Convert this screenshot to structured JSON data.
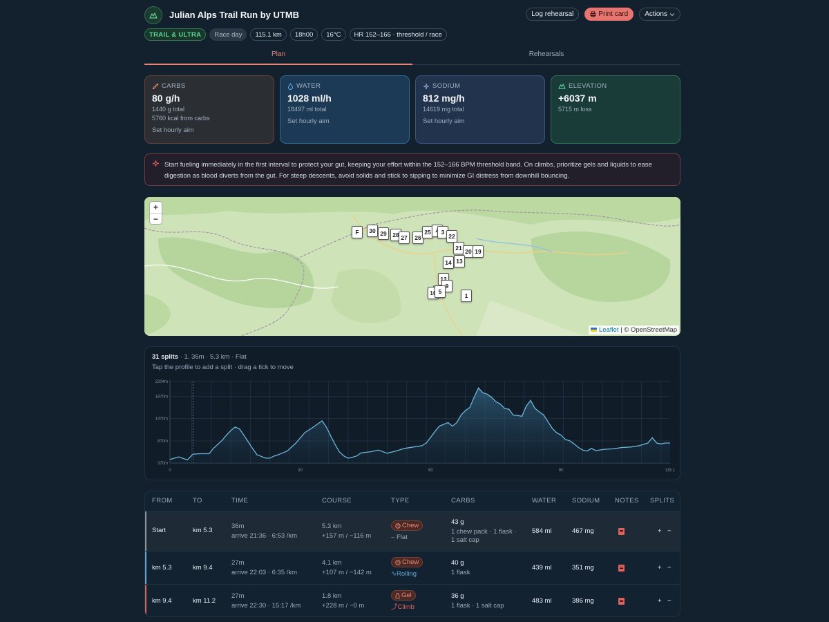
{
  "header": {
    "title": "Julian Alps Trail Run by UTMB",
    "buttons": {
      "log": "Log rehearsal",
      "print": "Print card",
      "actions": "Actions"
    },
    "chips": [
      "TRAIL & ULTRA",
      "Race day",
      "115.1 km",
      "18h00",
      "16°C",
      "HR 152–166 · threshold / race"
    ]
  },
  "tabs": [
    "Plan",
    "Rehearsals"
  ],
  "cards": [
    {
      "label": "CARBS",
      "value": "80 g/h",
      "sub1": "1440 g total",
      "sub2": "5760 kcal from carbs",
      "aim": "Set hourly aim"
    },
    {
      "label": "WATER",
      "value": "1028 ml/h",
      "sub1": "18497 ml total",
      "aim": "Set hourly aim"
    },
    {
      "label": "SODIUM",
      "value": "812 mg/h",
      "sub1": "14619 mg total",
      "aim": "Set hourly aim"
    },
    {
      "label": "ELEVATION",
      "value": "+6037 m",
      "sub1": "5715 m loss"
    }
  ],
  "tip": "Start fueling immediately in the first interval to protect your gut, keeping your effort within the 152–166 BPM threshold band. On climbs, prioritize gels and liquids to ease digestion as blood diverts from the gut. For steep descents, avoid solids and stick to sipping to minimize GI distress from downhill bouncing.",
  "map": {
    "zoom_in": "+",
    "zoom_out": "−",
    "attribution_leaflet": "Leaflet",
    "attribution_osm": "| © OpenStreetMap",
    "markers": [
      "F",
      "30",
      "29",
      "28",
      "27",
      "26",
      "25",
      "4",
      "3",
      "22",
      "21",
      "20",
      "19",
      "14",
      "13",
      "12",
      "11",
      "10",
      "9",
      "5",
      "1"
    ]
  },
  "profile": {
    "title_bold": "31 splits",
    "title_rest": " · 1. 36m · 5.3 km · Flat",
    "hint": "Tap the profile to add a split · drag a tick to move"
  },
  "chart_data": {
    "type": "area",
    "xlabel": "",
    "ylabel": "",
    "x_ticks": [
      "0",
      "30",
      "60",
      "90",
      "115.1"
    ],
    "y_ticks": [
      "370m",
      "870m",
      "1370m",
      "1870m",
      "2204m"
    ],
    "xlim": [
      0,
      115.1
    ],
    "ylim": [
      370,
      2204
    ],
    "x": [
      0,
      2,
      4,
      5.3,
      7,
      9,
      10,
      12,
      13,
      14,
      15,
      16,
      17,
      18,
      19,
      20,
      21,
      22,
      23,
      24,
      25,
      26,
      27,
      29,
      31,
      33,
      35,
      36,
      37,
      38,
      39,
      40,
      41,
      42,
      43,
      44,
      46,
      48,
      50,
      52,
      54,
      56,
      58,
      59,
      60,
      61,
      62,
      63,
      64,
      65,
      66,
      67,
      68,
      69,
      70,
      71,
      72,
      73,
      74,
      75,
      76,
      77,
      78,
      79,
      80,
      81,
      82,
      83,
      84,
      85,
      86,
      87,
      88,
      89,
      90,
      91,
      92,
      93,
      94,
      95,
      96,
      97,
      98,
      100,
      102,
      104,
      106,
      108,
      110,
      111,
      112,
      113,
      114,
      115.1
    ],
    "y": [
      450,
      510,
      440,
      570,
      580,
      580,
      700,
      880,
      1000,
      1100,
      1180,
      1140,
      1000,
      850,
      700,
      560,
      520,
      480,
      480,
      530,
      560,
      600,
      640,
      820,
      1050,
      1180,
      1320,
      1180,
      980,
      790,
      620,
      530,
      480,
      500,
      530,
      600,
      620,
      660,
      590,
      640,
      700,
      730,
      760,
      820,
      950,
      1080,
      1200,
      1240,
      1280,
      1200,
      1280,
      1450,
      1550,
      1620,
      1850,
      2060,
      1950,
      1920,
      1850,
      1750,
      1700,
      1600,
      1580,
      1450,
      1440,
      1420,
      1650,
      1780,
      1600,
      1520,
      1450,
      1300,
      1150,
      1050,
      1000,
      900,
      870,
      800,
      720,
      660,
      640,
      700,
      650,
      680,
      690,
      720,
      730,
      760,
      820,
      940,
      820,
      800,
      820,
      820
    ]
  },
  "table": {
    "headers": [
      "FROM",
      "TO",
      "TIME",
      "COURSE",
      "TYPE",
      "CARBS",
      "WATER",
      "SODIUM",
      "NOTES",
      "SPLITS"
    ],
    "rows": [
      {
        "from": "Start",
        "to": "km 5.3",
        "time": "36m",
        "arrive": "arrive 21:36 · 6:53 /km",
        "dist": "5.3 km",
        "elev": "+157 m / −116 m",
        "type": "Chew",
        "terrain": "Flat",
        "carbs": "43 g",
        "carbs_detail": "1 chew pack · 1 flask · 1 salt cap",
        "water": "584 ml",
        "sodium": "467 mg",
        "add": "+",
        "remove": "−"
      },
      {
        "from": "km 5.3",
        "to": "km 9.4",
        "time": "27m",
        "arrive": "arrive 22:03 · 6:35 /km",
        "dist": "4.1 km",
        "elev": "+107 m / −142 m",
        "type": "Chew",
        "terrain": "Rolling",
        "carbs": "40 g",
        "carbs_detail": "1 flask",
        "water": "439 ml",
        "sodium": "351 mg",
        "add": "+",
        "remove": "−"
      },
      {
        "from": "km 9.4",
        "to": "km 11.2",
        "time": "27m",
        "arrive": "arrive 22:30 · 15:17 /km",
        "dist": "1.8 km",
        "elev": "+228 m / −0 m",
        "type": "Gel",
        "terrain": "Climb",
        "carbs": "36 g",
        "carbs_detail": "1 flask · 1 salt cap",
        "water": "483 ml",
        "sodium": "386 mg",
        "add": "+",
        "remove": "−"
      }
    ]
  },
  "colors": {
    "accent": "#e88575",
    "carbs": "#e1605c",
    "water": "#5aa7d8",
    "elevation": "#5fd39a",
    "profile_line": "#6fb6d8"
  }
}
